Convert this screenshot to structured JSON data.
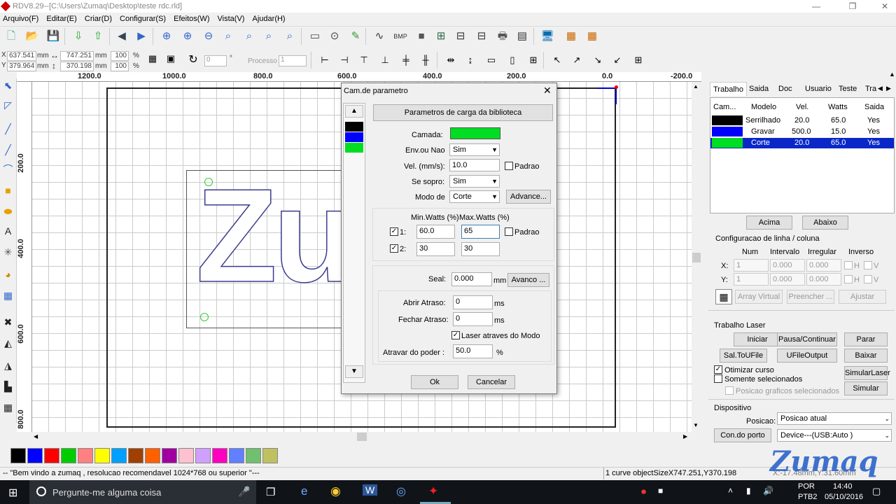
{
  "window": {
    "title": "RDV8.29--[C:\\Users\\Zumaq\\Desktop\\teste rdc.rld]"
  },
  "menu": [
    "Arquivo(F)",
    "Editar(E)",
    "Criar(D)",
    "Configurar(S)",
    "Efeitos(W)",
    "Vista(V)",
    "Ajudar(H)"
  ],
  "props": {
    "x_label": "X",
    "x_value": "637.541",
    "y_label": "Y",
    "y_value": "379.964",
    "unit": "mm",
    "w_value": "747.251",
    "h_value": "370.198",
    "sx": "100",
    "sy": "100",
    "pct": "%",
    "rotate": "0",
    "deg": "°",
    "process_label": "Processo",
    "process_value": "1"
  },
  "ruler": {
    "h": [
      "1200.0",
      "1000.0",
      "800.0",
      "600.0",
      "400.0",
      "200.0",
      "0.0",
      "-200.0"
    ],
    "v": [
      "200.0",
      "400.0",
      "600.0",
      "800.0"
    ]
  },
  "canvas": {
    "text": "Zum"
  },
  "dialog": {
    "title": "Cam.de parametro",
    "lib_button": "Parametros de carga da biblioteca",
    "layer_label": "Camada:",
    "layer_color": "#00dd22",
    "output_label": "Env.ou Nao",
    "output_value": "Sim",
    "speed_label": "Vel. (mm/s):",
    "speed_value": "10.0",
    "default_label": "Padrao",
    "blow_label": "Se sopro:",
    "blow_value": "Sim",
    "mode_label": "Modo de",
    "mode_value": "Corte",
    "advance_button": "Advance...",
    "minw_header": "Min.Watts (%)",
    "maxw_header": "Max.Watts (%)",
    "power_rows": [
      {
        "label": "1:",
        "min": "60.0",
        "max": "65",
        "checked": true
      },
      {
        "label": "2:",
        "min": "30",
        "max": "30",
        "checked": true
      }
    ],
    "seal_label": "Seal:",
    "seal_value": "0.000",
    "seal_unit": "mm",
    "seal_button": "Avanco ...",
    "open_delay_label": "Abrir Atraso:",
    "open_delay_value": "0",
    "close_delay_label": "Fechar Atraso:",
    "close_delay_value": "0",
    "ms": "ms",
    "laser_mode_label": "Laser atraves do Modo",
    "power_delay_label": "Atravar do poder :",
    "power_delay_value": "50.0",
    "pct": "%",
    "ok": "Ok",
    "cancel": "Cancelar",
    "layer_swatches": [
      "#000000",
      "#0000ff",
      "#00dd22"
    ]
  },
  "panel": {
    "tabs": [
      "Trabalho",
      "Saida",
      "Doc",
      "Usuario",
      "Teste",
      "Tra"
    ],
    "table_headers": [
      "Cam...",
      "Modelo",
      "Vel.",
      "Watts",
      "Saida"
    ],
    "layers": [
      {
        "color": "#000000",
        "model": "Serrilhado",
        "speed": "20.0",
        "watts": "65.0",
        "out": "Yes",
        "selected": false
      },
      {
        "color": "#0000ff",
        "model": "Gravar",
        "speed": "500.0",
        "watts": "15.0",
        "out": "Yes",
        "selected": false
      },
      {
        "color": "#00dd22",
        "model": "Corte",
        "speed": "20.0",
        "watts": "65.0",
        "out": "Yes",
        "selected": true
      }
    ],
    "up": "Acima",
    "down": "Abaixo",
    "array_title": "Configuracao de linha / coluna",
    "array_headers": [
      "Num",
      "Intervalo",
      "Irregular",
      "Inverso"
    ],
    "array_rows": [
      {
        "axis": "X:",
        "num": "1",
        "interval": "0.000",
        "irregular": "0.000",
        "inv": "H",
        "inv2": "V"
      },
      {
        "axis": "Y:",
        "num": "1",
        "interval": "0.000",
        "irregular": "0.000",
        "inv": "H",
        "inv2": "V"
      }
    ],
    "array_virtual": "Array Virtual",
    "fill": "Preencher ...",
    "adjust": "Ajustar",
    "job_title": "Trabalho Laser",
    "start": "Iniciar",
    "pause": "Pausa/Continuar",
    "stop": "Parar",
    "save_ufile": "Sal.ToUFile",
    "ufile_output": "UFileOutput",
    "download": "Baixar",
    "optimize": "Otimizar curso",
    "only_selected": "Somente selecionados",
    "pos_selected": "Posicao graficos selecionados",
    "sim_laser": "SimularLaser",
    "simulate": "Simular",
    "device_title": "Dispositivo",
    "position_label": "Posicao:",
    "position_value": "Posicao atual",
    "port_button": "Con.do porto",
    "device_value": "Device---(USB:Auto )"
  },
  "palette": [
    "#000000",
    "#0000ff",
    "#ff0000",
    "#00cc00",
    "#ff8080",
    "#ffff00",
    "#00a0ff",
    "#a04000",
    "#ff6000",
    "#a000a0",
    "#ffc0d0",
    "#d0a0ff",
    "#ff00c0",
    "#6080ff",
    "#70c070",
    "#c0c060"
  ],
  "status": {
    "left": "-- \"Bem vindo a zumaq , resolucao recomendavel 1024*768 ou superior \"---",
    "mid": "1 curve objectSizeX747.251,Y370.198",
    "right": "X:-17.48mm,Y:31.60mm"
  },
  "taskbar": {
    "search": "Pergunte-me alguma coisa",
    "lang1": "POR",
    "lang2": "PTB2",
    "time": "14:40",
    "date": "05/10/2016"
  },
  "watermark": "Zumaq"
}
